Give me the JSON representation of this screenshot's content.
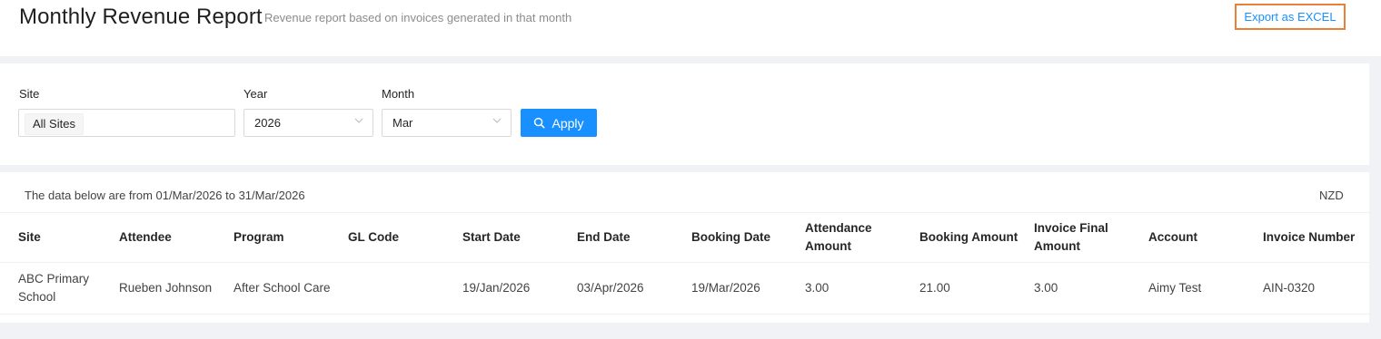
{
  "header": {
    "title": "Monthly Revenue Report",
    "subtitle": "Revenue report based on invoices generated in that month",
    "export_label": "Export as EXCEL"
  },
  "filters": {
    "site_label": "Site",
    "site_value": "All Sites",
    "year_label": "Year",
    "year_value": "2026",
    "month_label": "Month",
    "month_value": "Mar",
    "apply_label": "Apply"
  },
  "report": {
    "range_text": "The data below are from 01/Mar/2026 to 31/Mar/2026",
    "currency": "NZD",
    "columns": [
      {
        "label": "Site"
      },
      {
        "label": "Attendee"
      },
      {
        "label": "Program"
      },
      {
        "label": "GL Code"
      },
      {
        "label": "Start Date"
      },
      {
        "label": "End Date"
      },
      {
        "label": "Booking Date"
      },
      {
        "label": "Attendance Amount"
      },
      {
        "label": "Booking Amount"
      },
      {
        "label": "Invoice Final Amount"
      },
      {
        "label": "Account"
      },
      {
        "label": "Invoice Number"
      }
    ],
    "rows": [
      {
        "site": "ABC Primary School",
        "attendee": "Rueben Johnson",
        "program": "After School Care",
        "gl_code": "",
        "start_date": "19/Jan/2026",
        "end_date": "03/Apr/2026",
        "booking_date": "19/Mar/2026",
        "attendance_amount": "3.00",
        "booking_amount": "21.00",
        "invoice_final_amount": "3.00",
        "account": "Aimy Test",
        "invoice_number": "AIN-0320"
      }
    ]
  },
  "colors": {
    "primary": "#1890ff",
    "highlight_border": "#e8803a",
    "page_bg": "#f0f2f5"
  }
}
